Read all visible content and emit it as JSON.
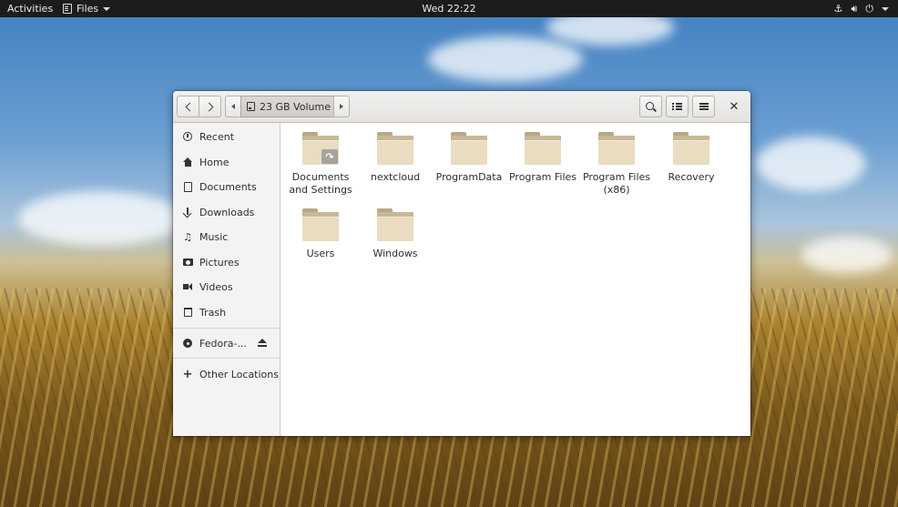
{
  "topbar": {
    "activities": "Activities",
    "app_name": "Files",
    "clock": "Wed 22:22",
    "status_icons": [
      "network-icon",
      "volume-icon",
      "power-icon"
    ]
  },
  "window": {
    "path": {
      "current": "23 GB Volume"
    },
    "sidebar": {
      "items": [
        {
          "label": "Recent",
          "icon": "clock-icon"
        },
        {
          "label": "Home",
          "icon": "home-icon"
        },
        {
          "label": "Documents",
          "icon": "document-icon"
        },
        {
          "label": "Downloads",
          "icon": "download-icon"
        },
        {
          "label": "Music",
          "icon": "music-icon"
        },
        {
          "label": "Pictures",
          "icon": "camera-icon"
        },
        {
          "label": "Videos",
          "icon": "video-icon"
        },
        {
          "label": "Trash",
          "icon": "trash-icon"
        }
      ],
      "device": {
        "label": "Fedora-...",
        "icon": "disk-icon"
      },
      "other": {
        "label": "Other Locations",
        "icon": "plus-icon"
      }
    },
    "files": [
      {
        "name": "Documents\nand Settings",
        "line1": "Documents",
        "line2": "and Settings",
        "is_link": true
      },
      {
        "name": "nextcloud",
        "line1": "nextcloud",
        "line2": ""
      },
      {
        "name": "ProgramData",
        "line1": "ProgramData",
        "line2": ""
      },
      {
        "name": "Program Files",
        "line1": "Program Files",
        "line2": ""
      },
      {
        "name": "Program Files (x86)",
        "line1": "Program Files",
        "line2": "(x86)"
      },
      {
        "name": "Recovery",
        "line1": "Recovery",
        "line2": ""
      },
      {
        "name": "Users",
        "line1": "Users",
        "line2": ""
      },
      {
        "name": "Windows",
        "line1": "Windows",
        "line2": ""
      }
    ]
  },
  "colors": {
    "topbar": "#1c1c1c",
    "folder_front": "#e9dcc0",
    "folder_back": "#c7b896",
    "sidebar": "#f4f3f2"
  }
}
